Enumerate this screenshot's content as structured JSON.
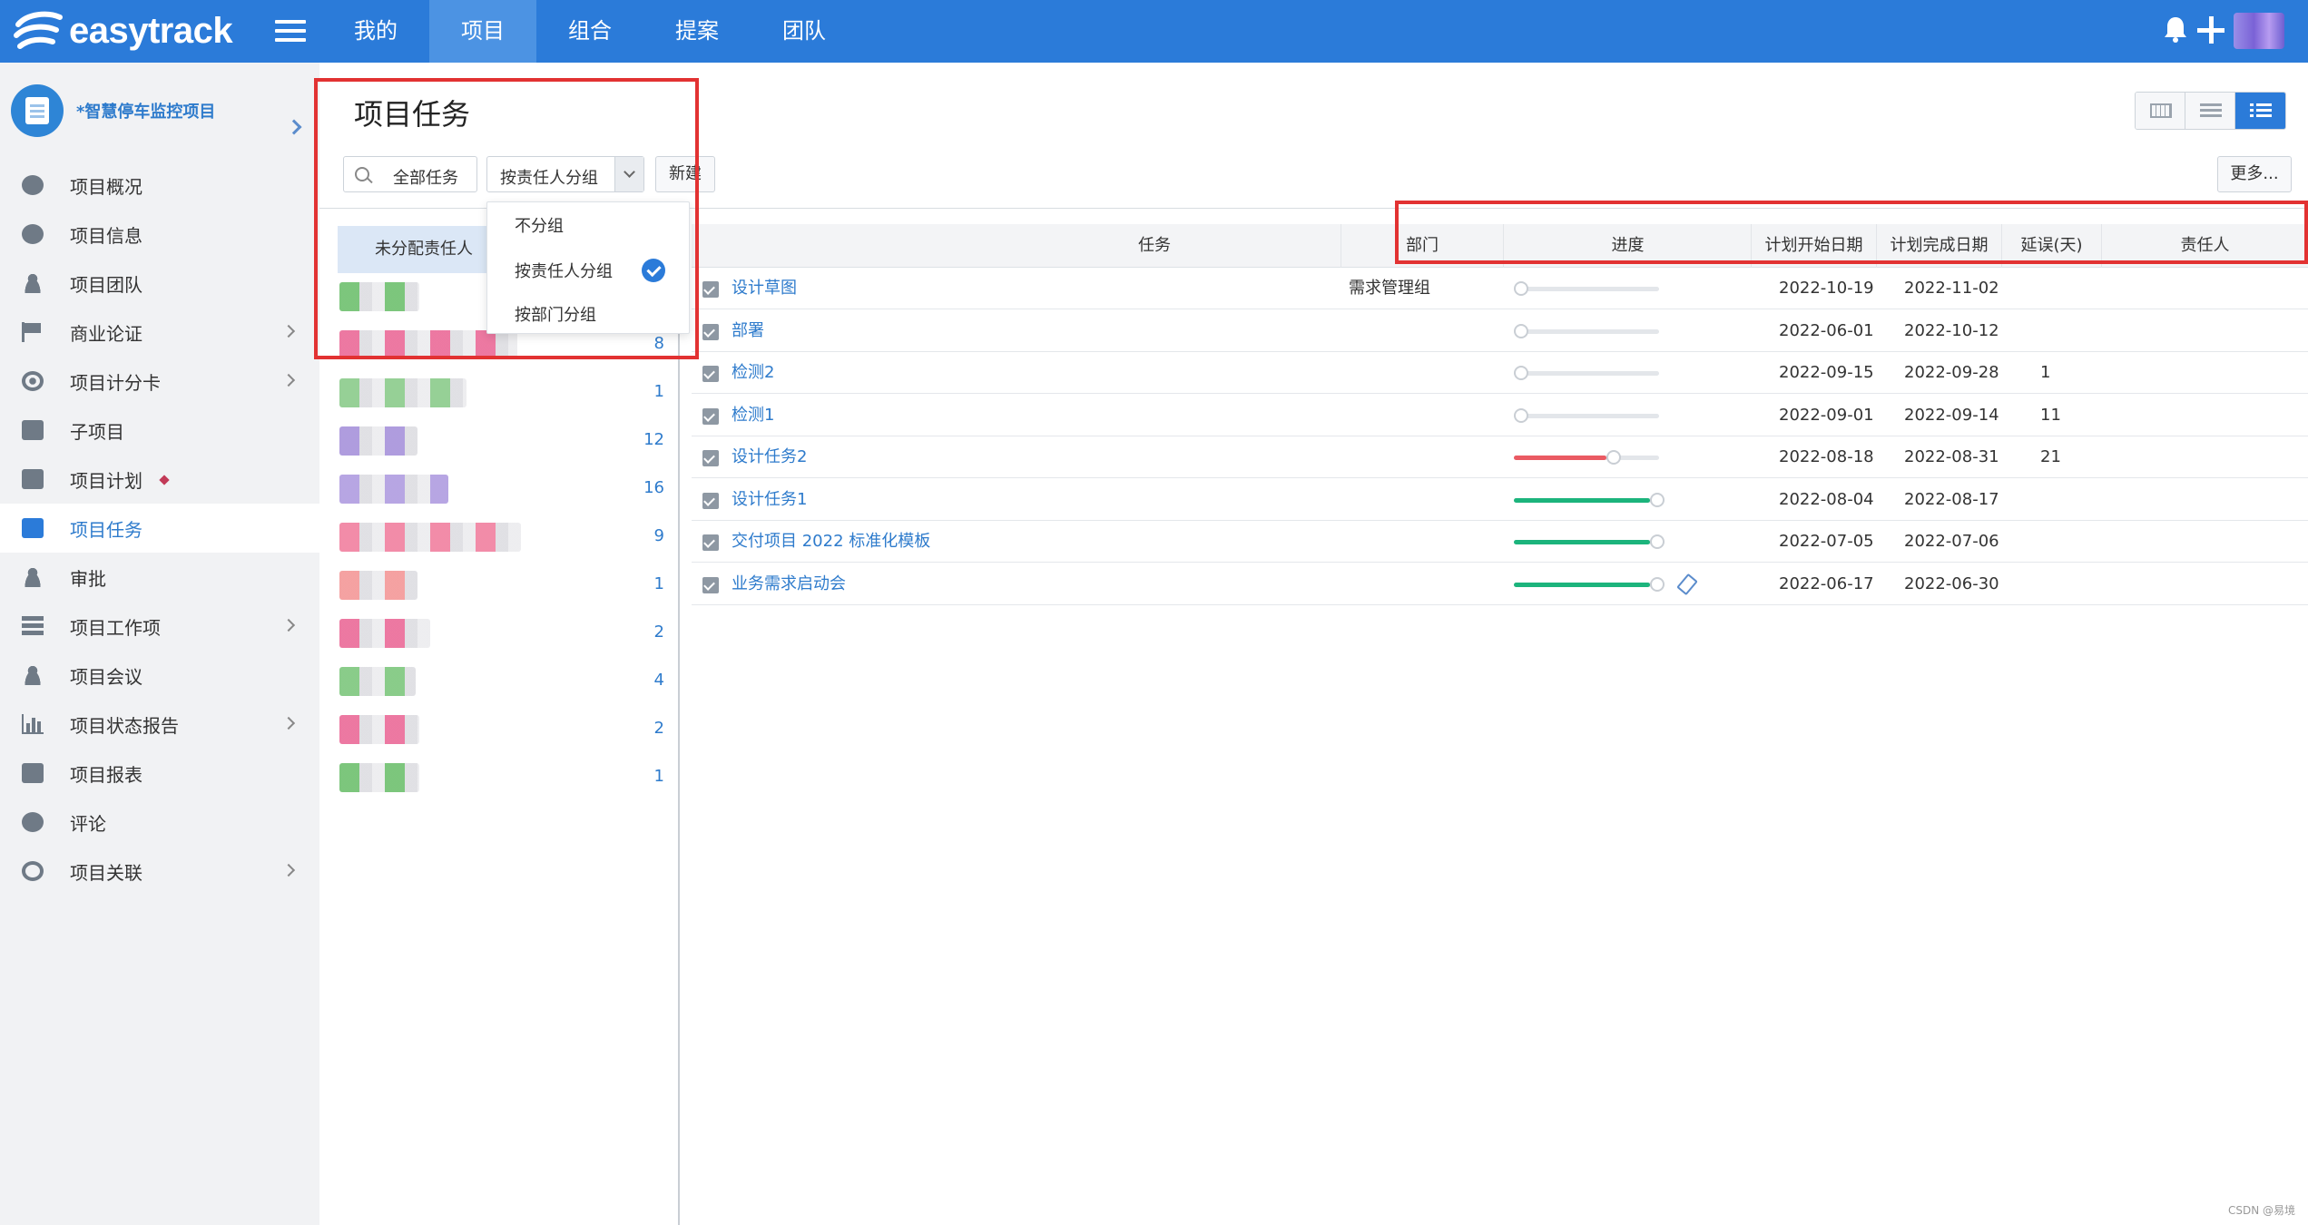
{
  "app": {
    "logo_text": "easytrack"
  },
  "topnav": [
    {
      "label": "我的",
      "active": false
    },
    {
      "label": "项目",
      "active": true
    },
    {
      "label": "组合",
      "active": false
    },
    {
      "label": "提案",
      "active": false
    },
    {
      "label": "团队",
      "active": false
    }
  ],
  "project": {
    "name": "*智慧停车监控项目"
  },
  "sidebar": {
    "items": [
      {
        "label": "项目概况",
        "icon": "pie-chart-icon",
        "has_submenu": false
      },
      {
        "label": "项目信息",
        "icon": "info-icon",
        "has_submenu": false
      },
      {
        "label": "项目团队",
        "icon": "team-icon",
        "has_submenu": false
      },
      {
        "label": "商业论证",
        "icon": "flag-icon",
        "has_submenu": true
      },
      {
        "label": "项目计分卡",
        "icon": "target-icon",
        "has_submenu": true
      },
      {
        "label": "子项目",
        "icon": "document-icon",
        "has_submenu": false
      },
      {
        "label": "项目计划",
        "icon": "plan-edit-icon",
        "has_submenu": false,
        "marker": true
      },
      {
        "label": "项目任务",
        "icon": "task-check-icon",
        "has_submenu": false,
        "active": true
      },
      {
        "label": "审批",
        "icon": "stamp-icon",
        "has_submenu": false
      },
      {
        "label": "项目工作项",
        "icon": "stack-icon",
        "has_submenu": true
      },
      {
        "label": "项目会议",
        "icon": "meeting-icon",
        "has_submenu": false
      },
      {
        "label": "项目状态报告",
        "icon": "bar-chart-icon",
        "has_submenu": true
      },
      {
        "label": "项目报表",
        "icon": "report-icon",
        "has_submenu": false
      },
      {
        "label": "评论",
        "icon": "comment-icon",
        "has_submenu": false
      },
      {
        "label": "项目关联",
        "icon": "link-icon",
        "has_submenu": true
      }
    ]
  },
  "page": {
    "title": "项目任务",
    "filter_label": "全部任务",
    "group_select_value": "按责任人分组",
    "new_label": "新建",
    "more_label": "更多...",
    "view_modes": [
      "calendar-view-icon",
      "rows-view-icon",
      "list-view-icon"
    ],
    "active_view": 2
  },
  "group_dropdown": {
    "options": [
      "不分组",
      "按责任人分组",
      "按部门分组"
    ],
    "selected": 1
  },
  "assignees": {
    "header": "未分配责任人",
    "rows": [
      {
        "count": "",
        "color": "#5cb85c",
        "w": 88
      },
      {
        "count": "8",
        "color": "#e8578a",
        "w": 196
      },
      {
        "count": "1",
        "color": "#7cc47c",
        "w": 140
      },
      {
        "count": "12",
        "color": "#9b84d6",
        "w": 86
      },
      {
        "count": "16",
        "color": "#a58fdc",
        "w": 120
      },
      {
        "count": "9",
        "color": "#ef6f93",
        "w": 200
      },
      {
        "count": "1",
        "color": "#f28a8a",
        "w": 86
      },
      {
        "count": "2",
        "color": "#e8578a",
        "w": 100
      },
      {
        "count": "4",
        "color": "#6cbf6c",
        "w": 84
      },
      {
        "count": "2",
        "color": "#e8578a",
        "w": 88
      },
      {
        "count": "1",
        "color": "#5cb85c",
        "w": 88
      }
    ]
  },
  "table": {
    "columns": {
      "task": "任务",
      "dept": "部门",
      "progress": "进度",
      "start": "计划开始日期",
      "end": "计划完成日期",
      "delay": "延误(天)",
      "owner": "责任人"
    },
    "rows": [
      {
        "name": "设计草图",
        "dept": "需求管理组",
        "progress": 0,
        "color": "#c9ced4",
        "start": "2022-10-19",
        "end": "2022-11-02",
        "delay": "",
        "owner": ""
      },
      {
        "name": "部署",
        "dept": "",
        "progress": 0,
        "color": "#c9ced4",
        "start": "2022-06-01",
        "end": "2022-10-12",
        "delay": "",
        "owner": ""
      },
      {
        "name": "检测2",
        "dept": "",
        "progress": 0,
        "color": "#c9ced4",
        "start": "2022-09-15",
        "end": "2022-09-28",
        "delay": "1",
        "owner": ""
      },
      {
        "name": "检测1",
        "dept": "",
        "progress": 0,
        "color": "#c9ced4",
        "start": "2022-09-01",
        "end": "2022-09-14",
        "delay": "11",
        "owner": ""
      },
      {
        "name": "设计任务2",
        "dept": "",
        "progress": 0.68,
        "color": "#ea5a63",
        "start": "2022-08-18",
        "end": "2022-08-31",
        "delay": "21",
        "owner": ""
      },
      {
        "name": "设计任务1",
        "dept": "",
        "progress": 1,
        "color": "#1cb47c",
        "start": "2022-08-04",
        "end": "2022-08-17",
        "delay": "",
        "owner": ""
      },
      {
        "name": "交付项目 2022 标准化模板",
        "dept": "",
        "progress": 1,
        "color": "#1cb47c",
        "start": "2022-07-05",
        "end": "2022-07-06",
        "delay": "",
        "owner": ""
      },
      {
        "name": "业务需求启动会",
        "dept": "",
        "progress": 1,
        "color": "#1cb47c",
        "start": "2022-06-17",
        "end": "2022-06-30",
        "delay": "",
        "owner": "",
        "editable": true
      }
    ]
  },
  "watermark": "CSDN @易境"
}
